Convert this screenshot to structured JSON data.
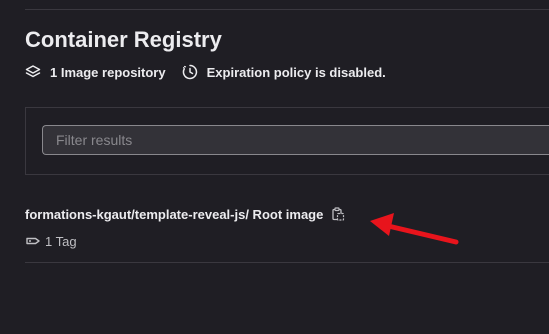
{
  "header": {
    "title": "Container Registry"
  },
  "meta": {
    "repositories": "1 Image repository",
    "repositories_icon": "layers-icon",
    "expiration": "Expiration policy is disabled.",
    "expiration_icon": "expire-clock-icon"
  },
  "filter": {
    "placeholder": "Filter results",
    "value": ""
  },
  "repository": {
    "name": "formations-kgaut/template-reveal-js/ Root image",
    "copy_icon": "copy-to-clipboard-icon",
    "tags": "1 Tag",
    "tags_icon": "tag-icon"
  },
  "annotation": {
    "arrow_icon": "red-arrow-annotation",
    "color": "#e8141c"
  },
  "colors": {
    "background": "#1f1e24",
    "text": "#ececef",
    "muted": "#89888d",
    "border": "#3a383f"
  }
}
